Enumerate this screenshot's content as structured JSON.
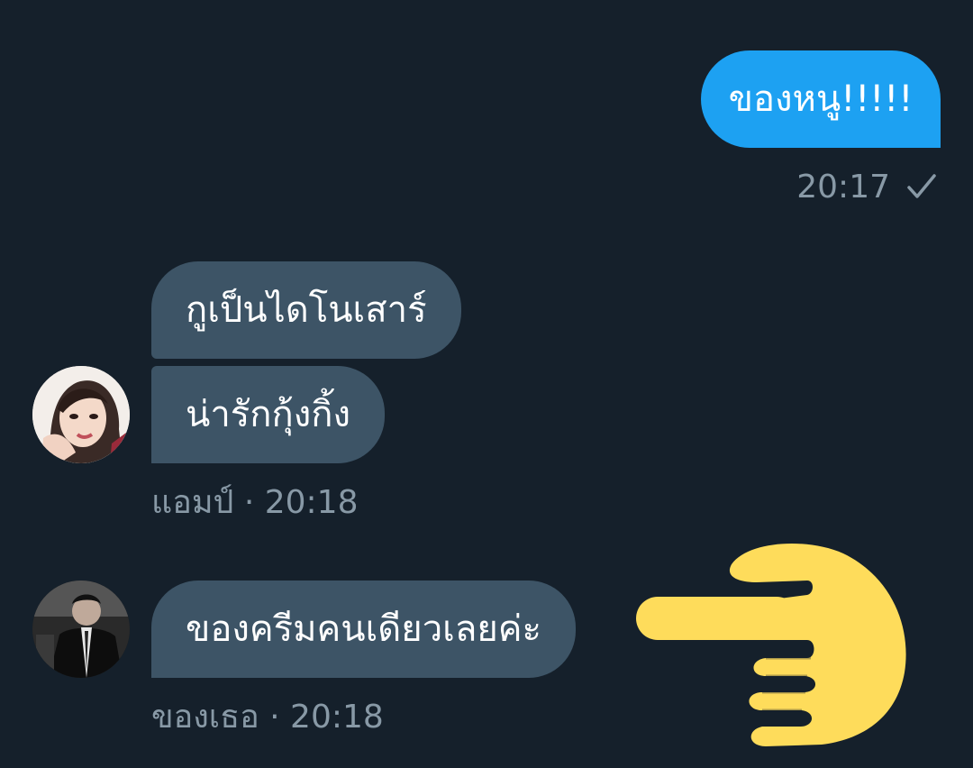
{
  "messages": {
    "outgoing": {
      "text": "ของหนู!!!!!",
      "time": "20:17",
      "status_icon": "check-icon"
    },
    "incoming_group_1": {
      "bubbles": [
        "กูเป็นไดโนเสาร์",
        "น่ารักกุ้งกิ้ง"
      ],
      "meta": "แอมป์ · 20:18"
    },
    "incoming_group_2": {
      "bubbles": [
        "ของครีมคนเดียวเลยค่ะ"
      ],
      "meta": "ของเธอ · 20:18"
    }
  },
  "colors": {
    "background": "#15202b",
    "outgoing_bubble": "#1da1f2",
    "incoming_bubble": "#3d5466",
    "meta_text": "#8899a6",
    "emoji_yellow": "#fedc5b"
  },
  "sticker": {
    "icon": "pointing-hand-icon"
  }
}
